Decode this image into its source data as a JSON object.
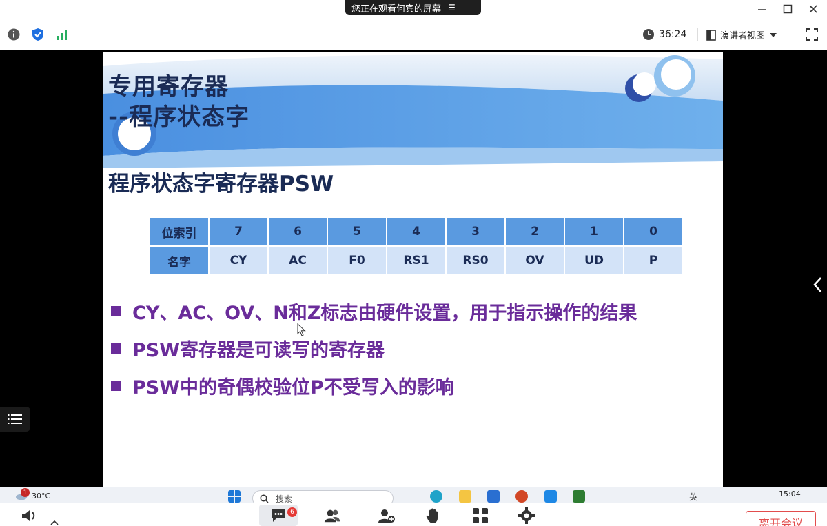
{
  "window": {
    "share_banner": "您正在观看何宾的屏幕",
    "share_menu_glyph": "☰"
  },
  "toolbar": {
    "timer": "36:24",
    "view_mode": "演讲者视图"
  },
  "slide": {
    "title_line1": "专用寄存器",
    "title_line2": "--程序状态字",
    "subtitle": "程序状态字寄存器PSW",
    "table": {
      "header_label": "位索引",
      "name_label": "名字",
      "bits": [
        "7",
        "6",
        "5",
        "4",
        "3",
        "2",
        "1",
        "0"
      ],
      "names": [
        "CY",
        "AC",
        "F0",
        "RS1",
        "RS0",
        "OV",
        "UD",
        "P"
      ]
    },
    "bullets": [
      "CY、AC、OV、N和Z标志由硬件设置，用于指示操作的结果",
      "PSW寄存器是可读写的寄存器",
      "PSW中的奇偶校验位P不受写入的影响"
    ]
  },
  "taskbar": {
    "weather_badge": "1",
    "temperature": "30°C",
    "search_placeholder": "搜索",
    "input_lang": "英",
    "clock": "15:04"
  },
  "controls": {
    "chat_badge": "6",
    "leave_label": "离开会议"
  },
  "colors": {
    "title": "#1a2b55",
    "bullet": "#6a2c9a",
    "table_header": "#5a9ae0",
    "table_cell": "#d3e3f8",
    "leave": "#e24c4c"
  }
}
